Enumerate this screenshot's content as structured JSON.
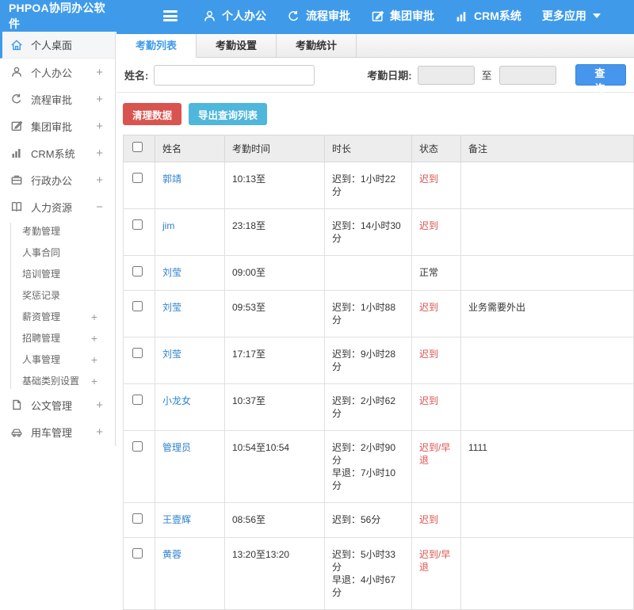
{
  "header": {
    "app_title": "PHPOA协同办公软件",
    "nav_items": [
      {
        "label": "个人办公"
      },
      {
        "label": "流程审批"
      },
      {
        "label": "集团审批"
      },
      {
        "label": "CRM系统"
      },
      {
        "label": "更多应用"
      }
    ]
  },
  "sidebar": {
    "items": [
      {
        "label": "个人桌面",
        "expander": ""
      },
      {
        "label": "个人办公",
        "expander": "+"
      },
      {
        "label": "流程审批",
        "expander": "+"
      },
      {
        "label": "集团审批",
        "expander": "+"
      },
      {
        "label": "CRM系统",
        "expander": "+"
      },
      {
        "label": "行政办公",
        "expander": "+"
      },
      {
        "label": "人力资源",
        "expander": "−"
      }
    ],
    "hr_subitems": [
      {
        "label": "考勤管理",
        "expander": ""
      },
      {
        "label": "人事合同",
        "expander": ""
      },
      {
        "label": "培训管理",
        "expander": ""
      },
      {
        "label": "奖惩记录",
        "expander": ""
      },
      {
        "label": "薪资管理",
        "expander": "+"
      },
      {
        "label": "招聘管理",
        "expander": "+"
      },
      {
        "label": "人事管理",
        "expander": "+"
      },
      {
        "label": "基础类别设置",
        "expander": "+"
      }
    ],
    "bottom_items": [
      {
        "label": "公文管理",
        "expander": "+"
      },
      {
        "label": "用车管理",
        "expander": "+"
      }
    ]
  },
  "tabs": [
    {
      "label": "考勤列表"
    },
    {
      "label": "考勤设置"
    },
    {
      "label": "考勤统计"
    }
  ],
  "filter": {
    "name_label": "姓名:",
    "date_label": "考勤日期:",
    "to_label": "至",
    "search_button": "查 询"
  },
  "toolbar": {
    "clean_button": "清理数据",
    "export_button": "导出查询列表"
  },
  "table": {
    "columns": [
      "姓名",
      "考勤时间",
      "时长",
      "状态",
      "备注"
    ],
    "rows": [
      {
        "name": "郭靖",
        "time": "10:13至",
        "duration": [
          "迟到：1小时22分"
        ],
        "status": "迟到",
        "status_color": "red",
        "remark": ""
      },
      {
        "name": "jim",
        "time": "23:18至",
        "duration": [
          "迟到：14小时30分"
        ],
        "status": "迟到",
        "status_color": "red",
        "remark": ""
      },
      {
        "name": "刘莹",
        "time": "09:00至",
        "duration": [],
        "status": "正常",
        "status_color": "normal",
        "remark": ""
      },
      {
        "name": "刘莹",
        "time": "09:53至",
        "duration": [
          "迟到：1小时88分"
        ],
        "status": "迟到",
        "status_color": "red",
        "remark": "业务需要外出"
      },
      {
        "name": "刘莹",
        "time": "17:17至",
        "duration": [
          "迟到：9小时28分"
        ],
        "status": "迟到",
        "status_color": "red",
        "remark": ""
      },
      {
        "name": "小龙女",
        "time": "10:37至",
        "duration": [
          "迟到：2小时62分"
        ],
        "status": "迟到",
        "status_color": "red",
        "remark": ""
      },
      {
        "name": "管理员",
        "time": "10:54至10:54",
        "duration": [
          "迟到：2小时90分",
          "早退：7小时10分"
        ],
        "status": "迟到/早退",
        "status_color": "red",
        "remark": "1111"
      },
      {
        "name": "王壹辉",
        "time": "08:56至",
        "duration": [
          "迟到：56分"
        ],
        "status": "迟到",
        "status_color": "red",
        "remark": ""
      },
      {
        "name": "黄蓉",
        "time": "13:20至13:20",
        "duration": [
          "迟到：5小时33分",
          "早退：4小时67分"
        ],
        "status": "迟到/早退",
        "status_color": "red",
        "remark": ""
      }
    ]
  },
  "colors": {
    "header_blue": "#3f9bea",
    "accent_blue": "#3d9aec",
    "search_button_blue": "#4596ec",
    "clean_button_red": "#d9534f",
    "export_button_teal": "#4fb6dc",
    "link_blue": "#2f81cc",
    "status_red": "#d9534f"
  }
}
